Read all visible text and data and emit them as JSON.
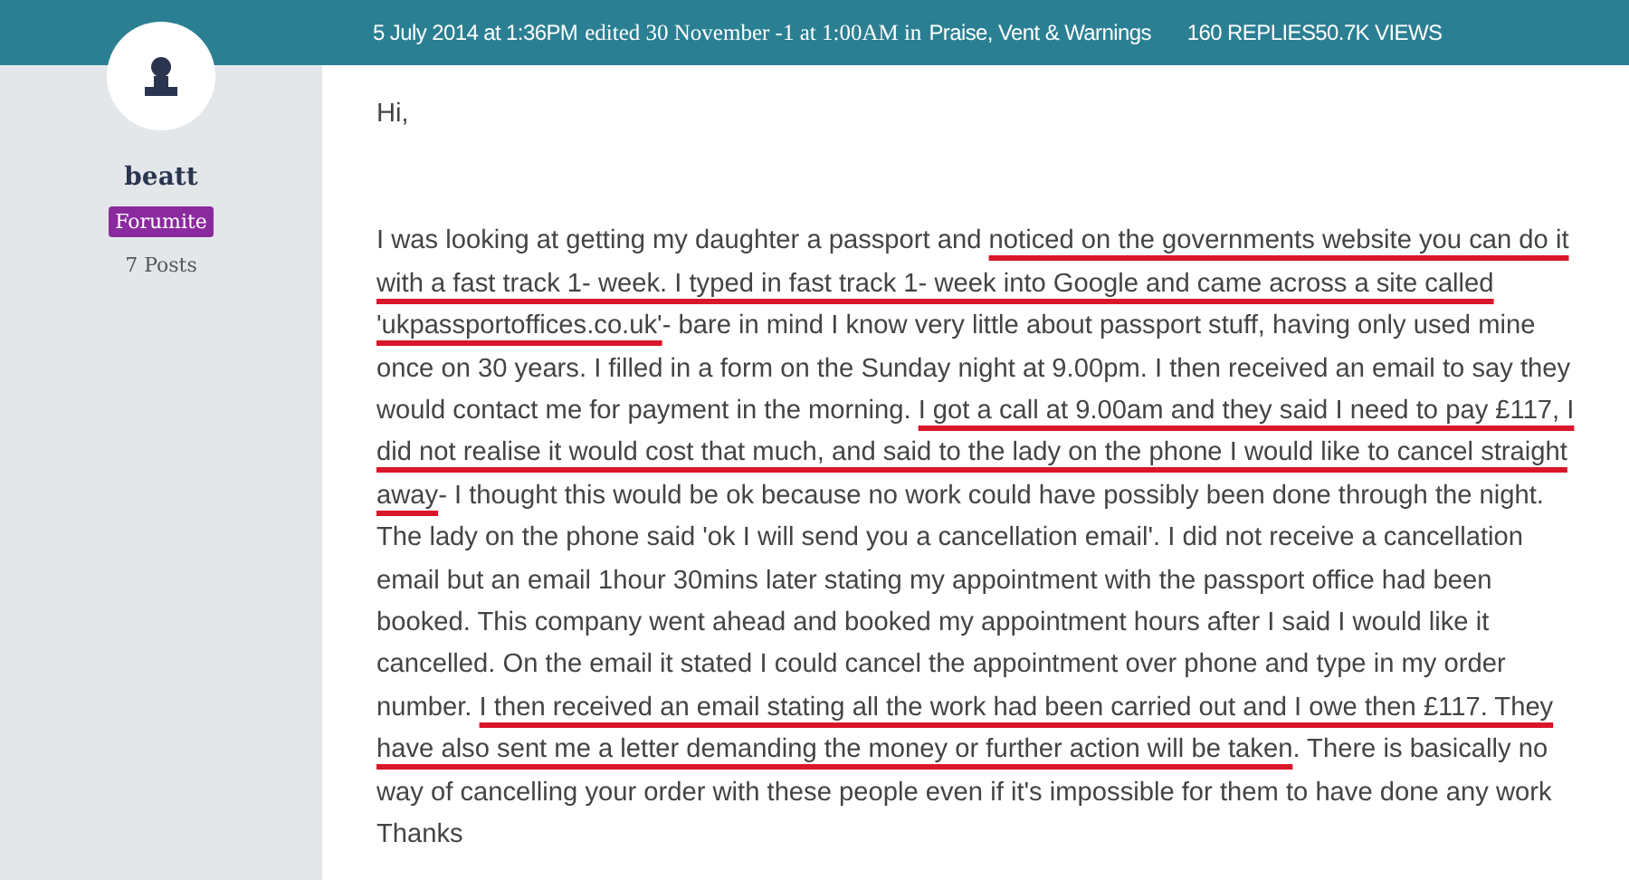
{
  "header": {
    "posted": "5 July 2014 at 1:36PM",
    "edited": "edited 30 November -1 at 1:00AM in",
    "category": "Praise, Vent & Warnings",
    "replies": "160 REPLIES",
    "views": "50.7K VIEWS"
  },
  "author": {
    "name": "beatt",
    "badge": "Forumite",
    "posts": "7 Posts"
  },
  "post": {
    "greeting": "Hi,",
    "segments": [
      {
        "text": "I was looking at getting my daughter a passport and ",
        "underlined": false
      },
      {
        "text": "noticed on the governments website you can do it with a fast track 1- week. I typed in fast track 1- week into Google and came across a site called 'ukpassportoffices.co.uk'",
        "underlined": true
      },
      {
        "text": "- bare in mind I know very little about passport stuff, having only used mine once on 30 years. I filled in a form on the Sunday night at 9.00pm. I then received an email to say they would contact me for payment in the morning. ",
        "underlined": false
      },
      {
        "text": "I got a call at 9.00am and they said I need to pay £117, I did not realise it would cost that much, and said to the lady on the phone I would like to cancel straight away",
        "underlined": true
      },
      {
        "text": "- I thought this would be ok because no work could have possibly been done through the night. The lady on the phone said 'ok I will send you a cancellation email'. I did not receive a cancellation email but an email 1hour 30mins later stating my appointment with the passport office had been booked. This company went ahead and booked my appointment hours after I said I would like it cancelled. On the email it stated I could cancel the appointment over phone and type in my order number. ",
        "underlined": false
      },
      {
        "text": "I then received an email stating all the work had been carried out and I owe then £117. They have also sent me a letter demanding the money or further action will be taken",
        "underlined": true
      },
      {
        "text": ". There is basically no way of cancelling your order with these people even if it's impossible for them to have done any work",
        "underlined": false
      }
    ],
    "signoff": "Thanks"
  }
}
